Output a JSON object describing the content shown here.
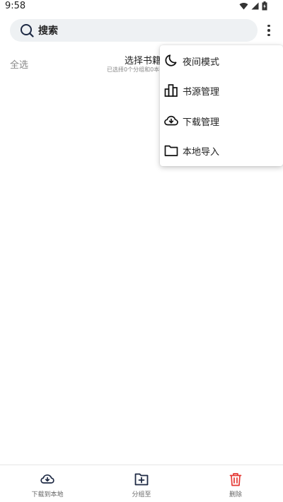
{
  "status_bar": {
    "time": "9:58",
    "icons": [
      "wifi-icon",
      "signal-icon",
      "battery-icon"
    ]
  },
  "search": {
    "placeholder": "搜索",
    "icon": "search-icon"
  },
  "more_menu": {
    "icon": "more-vert-icon"
  },
  "selection_header": {
    "select_all": "全选",
    "title": "选择书籍",
    "subtitle": "已选择0个分组和0本书籍"
  },
  "popup_menu": {
    "items": [
      {
        "label": "夜间模式",
        "icon": "moon-icon"
      },
      {
        "label": "书源管理",
        "icon": "bookshelf-icon"
      },
      {
        "label": "下载管理",
        "icon": "cloud-download-icon"
      },
      {
        "label": "本地导入",
        "icon": "folder-icon"
      }
    ]
  },
  "bottom_bar": {
    "items": [
      {
        "label": "下载到本地",
        "icon": "cloud-download-icon"
      },
      {
        "label": "分组至",
        "icon": "folder-add-icon"
      },
      {
        "label": "删除",
        "icon": "trash-icon"
      }
    ]
  },
  "colors": {
    "search_bg": "#eef1f3",
    "accent_dark": "#1e2a44",
    "delete_red": "#e53935"
  }
}
